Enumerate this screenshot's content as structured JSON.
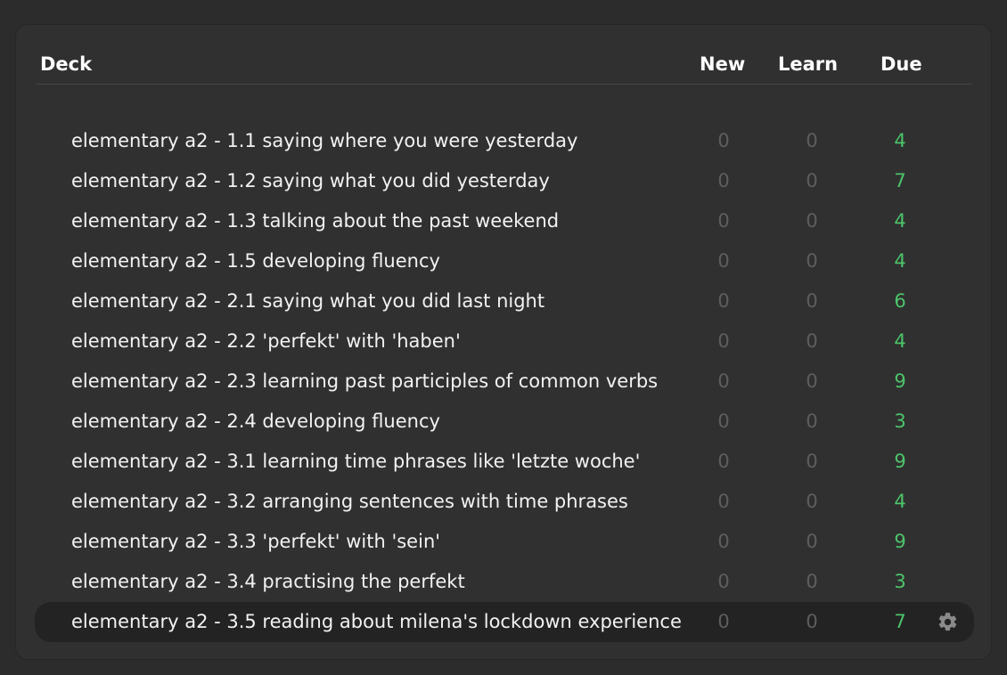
{
  "header": {
    "deck": "Deck",
    "new": "New",
    "learn": "Learn",
    "due": "Due"
  },
  "decks": [
    {
      "name": "elementary a2 - 1.1 saying where you were yesterday",
      "new": "0",
      "learn": "0",
      "due": "4"
    },
    {
      "name": "elementary a2 - 1.2 saying what you did yesterday",
      "new": "0",
      "learn": "0",
      "due": "7"
    },
    {
      "name": "elementary a2 - 1.3 talking about the past weekend",
      "new": "0",
      "learn": "0",
      "due": "4"
    },
    {
      "name": "elementary a2 - 1.5 developing fluency",
      "new": "0",
      "learn": "0",
      "due": "4"
    },
    {
      "name": "elementary a2 - 2.1 saying what you did last night",
      "new": "0",
      "learn": "0",
      "due": "6"
    },
    {
      "name": "elementary a2 - 2.2 'perfekt' with 'haben'",
      "new": "0",
      "learn": "0",
      "due": "4"
    },
    {
      "name": "elementary a2 - 2.3 learning past participles of common verbs",
      "new": "0",
      "learn": "0",
      "due": "9"
    },
    {
      "name": "elementary a2 - 2.4 developing fluency",
      "new": "0",
      "learn": "0",
      "due": "3"
    },
    {
      "name": "elementary a2 - 3.1 learning time phrases like 'letzte woche'",
      "new": "0",
      "learn": "0",
      "due": "9"
    },
    {
      "name": "elementary a2 - 3.2 arranging sentences with time phrases",
      "new": "0",
      "learn": "0",
      "due": "4"
    },
    {
      "name": "elementary a2 - 3.3 'perfekt' with 'sein'",
      "new": "0",
      "learn": "0",
      "due": "9"
    },
    {
      "name": "elementary a2 - 3.4 practising the perfekt",
      "new": "0",
      "learn": "0",
      "due": "3"
    },
    {
      "name": "elementary a2 - 3.5 reading about milena's lockdown experience",
      "new": "0",
      "learn": "0",
      "due": "7",
      "current": true
    }
  ],
  "colors": {
    "due": "#4cc46a",
    "zero": "#5e5e5e",
    "current_row": "#232323"
  },
  "icons": {
    "options": "gear-icon"
  }
}
